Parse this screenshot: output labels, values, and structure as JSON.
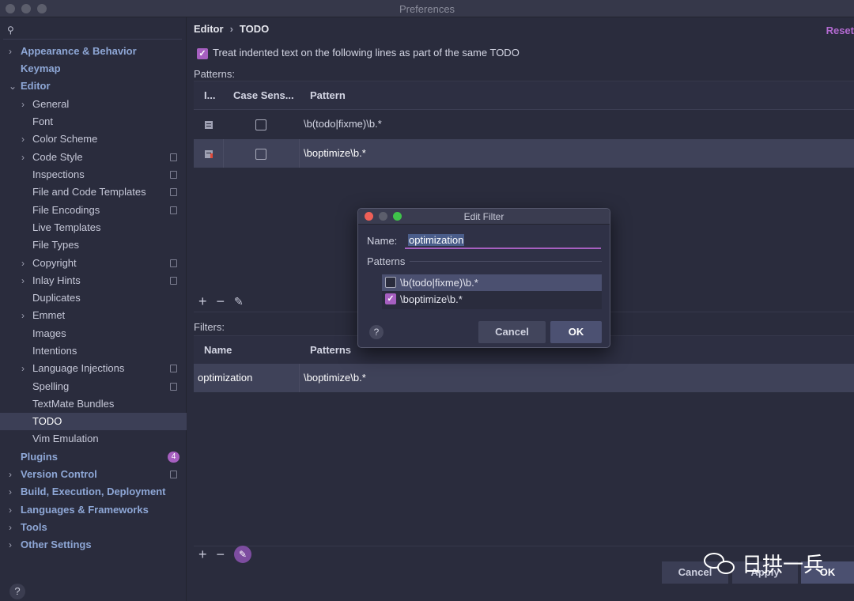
{
  "window": {
    "title": "Preferences"
  },
  "sidebar": {
    "search_icon": "search-icon",
    "items": [
      {
        "label": "Appearance & Behavior",
        "level": 0,
        "chevron": "›"
      },
      {
        "label": "Keymap",
        "level": 0,
        "chevron": ""
      },
      {
        "label": "Editor",
        "level": 0,
        "chevron": "⌄"
      },
      {
        "label": "General",
        "level": 1,
        "chevron": "›"
      },
      {
        "label": "Font",
        "level": 1,
        "chevron": ""
      },
      {
        "label": "Color Scheme",
        "level": 1,
        "chevron": "›"
      },
      {
        "label": "Code Style",
        "level": 1,
        "chevron": "›"
      },
      {
        "label": "Inspections",
        "level": 1,
        "chevron": ""
      },
      {
        "label": "File and Code Templates",
        "level": 1,
        "chevron": ""
      },
      {
        "label": "File Encodings",
        "level": 1,
        "chevron": ""
      },
      {
        "label": "Live Templates",
        "level": 1,
        "chevron": ""
      },
      {
        "label": "File Types",
        "level": 1,
        "chevron": ""
      },
      {
        "label": "Copyright",
        "level": 1,
        "chevron": "›"
      },
      {
        "label": "Inlay Hints",
        "level": 1,
        "chevron": "›"
      },
      {
        "label": "Duplicates",
        "level": 1,
        "chevron": ""
      },
      {
        "label": "Emmet",
        "level": 1,
        "chevron": "›"
      },
      {
        "label": "Images",
        "level": 1,
        "chevron": ""
      },
      {
        "label": "Intentions",
        "level": 1,
        "chevron": ""
      },
      {
        "label": "Language Injections",
        "level": 1,
        "chevron": "›"
      },
      {
        "label": "Spelling",
        "level": 1,
        "chevron": ""
      },
      {
        "label": "TextMate Bundles",
        "level": 1,
        "chevron": ""
      },
      {
        "label": "TODO",
        "level": 1,
        "chevron": ""
      },
      {
        "label": "Vim Emulation",
        "level": 1,
        "chevron": ""
      },
      {
        "label": "Plugins",
        "level": 0,
        "chevron": ""
      },
      {
        "label": "Version Control",
        "level": 0,
        "chevron": "›"
      },
      {
        "label": "Build, Execution, Deployment",
        "level": 0,
        "chevron": "›"
      },
      {
        "label": "Languages & Frameworks",
        "level": 0,
        "chevron": "›"
      },
      {
        "label": "Tools",
        "level": 0,
        "chevron": "›"
      },
      {
        "label": "Other Settings",
        "level": 0,
        "chevron": "›"
      }
    ],
    "plugins_badge": "4",
    "help": "?"
  },
  "breadcrumb": {
    "parent": "Editor",
    "separator": "›",
    "current": "TODO"
  },
  "reset_label": "Reset",
  "treat_indented": {
    "label": "Treat indented text on the following lines as part of the same TODO",
    "checked": true
  },
  "patterns": {
    "label": "Patterns:",
    "columns": [
      "I...",
      "Case Sens...",
      "Pattern"
    ],
    "rows": [
      {
        "icon": "todo-icon",
        "case_sensitive": false,
        "pattern": "\\b(todo|fixme)\\b.*"
      },
      {
        "icon": "warning-todo-icon",
        "case_sensitive": false,
        "pattern": "\\boptimize\\b.*"
      }
    ],
    "toolbar": {
      "add": "+",
      "remove": "−",
      "edit": "✎"
    }
  },
  "filters": {
    "label": "Filters:",
    "columns": [
      "Name",
      "Patterns"
    ],
    "rows": [
      {
        "name": "optimization",
        "patterns": "\\boptimize\\b.*"
      }
    ],
    "toolbar": {
      "add": "+",
      "remove": "−",
      "edit": "✎"
    }
  },
  "footer": {
    "cancel": "Cancel",
    "apply": "Apply",
    "ok": "OK"
  },
  "watermark": {
    "text": "日拱一兵"
  },
  "dialog": {
    "title": "Edit Filter",
    "name_label": "Name:",
    "name_value": "optimization",
    "patterns_label": "Patterns",
    "items": [
      {
        "pattern": "\\b(todo|fixme)\\b.*",
        "checked": false
      },
      {
        "pattern": "\\boptimize\\b.*",
        "checked": true
      }
    ],
    "help": "?",
    "cancel": "Cancel",
    "ok": "OK"
  },
  "colors": {
    "accent": "#a65fc0",
    "background": "#2a2c3d",
    "selection": "#3f4259",
    "sidebar_heading": "#8ea7d6"
  }
}
